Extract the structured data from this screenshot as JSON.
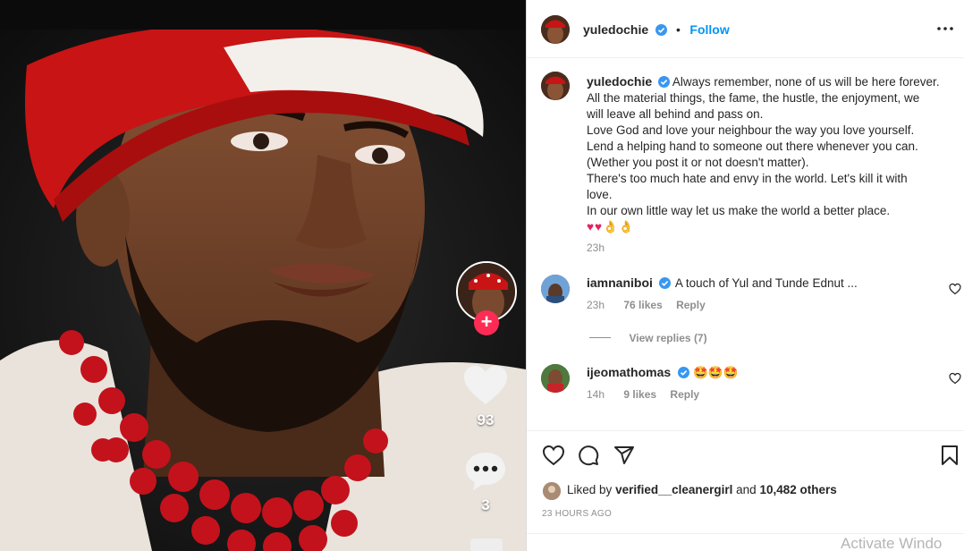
{
  "post": {
    "username": "yuledochie",
    "follow_label": "Follow",
    "dot": "•",
    "caption_lines": [
      "Always remember, none of us will be here forever.",
      "All the material things, the fame, the hustle, the enjoyment, we",
      "will leave all behind and pass on.",
      "Love God and love your neighbour the way you love yourself.",
      "Lend a helping hand to someone out there whenever you can.",
      "(Wether you post it or not doesn't matter).",
      "There's too much hate and envy in the world. Let's kill it with",
      "love.",
      "In our own little way let us make the world a better place.",
      "♥♥👌👌"
    ],
    "caption_time": "23h",
    "likes_summary_prefix": "Liked by",
    "likes_summary_user": "verified__cleanergirl",
    "likes_summary_and": "and",
    "likes_summary_count": "10,482 others",
    "timestamp": "23 HOURS AGO"
  },
  "comments": [
    {
      "username": "iamnaniboi",
      "text": "A touch of Yul and Tunde Ednut ...",
      "time": "23h",
      "likes": "76 likes",
      "reply_label": "Reply",
      "view_replies": "View replies (7)"
    },
    {
      "username": "ijeomathomas",
      "text": "🤩🤩🤩",
      "time": "14h",
      "likes": "9 likes",
      "reply_label": "Reply"
    }
  ],
  "media": {
    "like_count": "93",
    "comment_count": "3"
  },
  "watermark": "Activate Windo",
  "colors": {
    "accent": "#0095f6",
    "verified": "#3897f0",
    "tiktok_red": "#fe2c55"
  }
}
